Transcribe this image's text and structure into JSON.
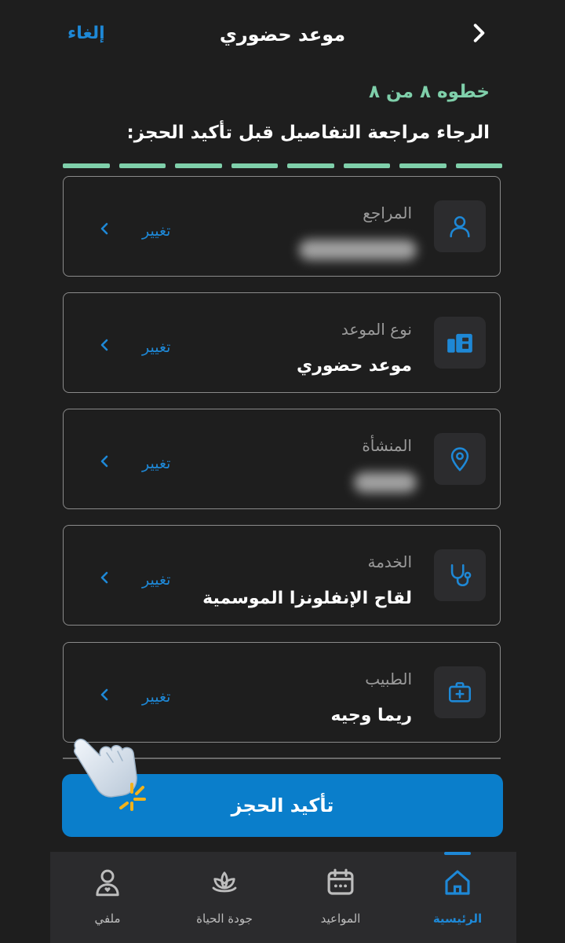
{
  "header": {
    "title": "موعد حضوري",
    "cancel_label": "إلغاء"
  },
  "step_text": "خطوه ٨ من ٨",
  "instruction": "الرجاء مراجعة التفاصيل قبل تأكيد الحجز:",
  "progress": {
    "total_steps": 8,
    "completed_steps": 8,
    "color": "#7fcfaa"
  },
  "cards": [
    {
      "label": "المراجع",
      "value": "",
      "value_blurred": true,
      "change_label": "تغيير",
      "icon": "person-icon"
    },
    {
      "label": "نوع الموعد",
      "value": "موعد حضوري",
      "value_blurred": false,
      "change_label": "تغيير",
      "icon": "appointment-type-icon"
    },
    {
      "label": "المنشأة",
      "value": "",
      "value_blurred": true,
      "change_label": "تغيير",
      "icon": "location-pin-icon"
    },
    {
      "label": "الخدمة",
      "value": "لقاح الإنفلونزا الموسمية",
      "value_blurred": false,
      "change_label": "تغيير",
      "icon": "stethoscope-icon"
    },
    {
      "label": "الطبيب",
      "value": "ريما وجيه",
      "value_blurred": false,
      "change_label": "تغيير",
      "icon": "medical-kit-icon"
    }
  ],
  "confirm_label": "تأكيد الحجز",
  "bottom_nav": [
    {
      "label": "الرئيسية",
      "icon": "home-icon",
      "active": true
    },
    {
      "label": "المواعيد",
      "icon": "calendar-icon",
      "active": false
    },
    {
      "label": "جودة الحياة",
      "icon": "lotus-icon",
      "active": false
    },
    {
      "label": "ملفي",
      "icon": "profile-icon",
      "active": false
    }
  ],
  "colors": {
    "background": "#1e1e1e",
    "accent_blue": "#1e88d6",
    "accent_green": "#7fcfaa",
    "button_blue": "#0a7ecb",
    "card_border": "#8a8a8a"
  }
}
